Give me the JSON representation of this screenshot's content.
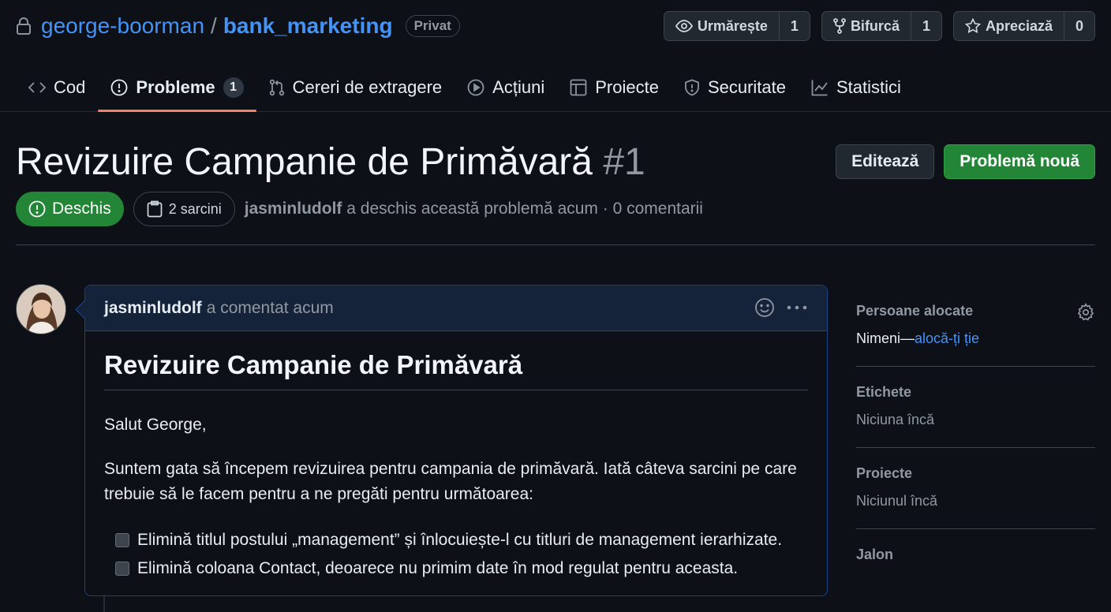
{
  "repo": {
    "owner": "george-boorman",
    "separator": "/",
    "name": "bank_marketing",
    "visibility": "Privat",
    "actions": [
      {
        "label": "Urmărește",
        "count": "1",
        "icon": "eye-icon"
      },
      {
        "label": "Bifurcă",
        "count": "1",
        "icon": "repo-forked-icon"
      },
      {
        "label": "Apreciază",
        "count": "0",
        "icon": "star-icon"
      }
    ]
  },
  "nav": {
    "tabs": [
      {
        "label": "Cod",
        "icon": "code-icon"
      },
      {
        "label": "Probleme",
        "icon": "issue-opened-icon",
        "counter": "1",
        "selected": true
      },
      {
        "label": "Cereri de extragere",
        "icon": "git-pull-request-icon"
      },
      {
        "label": "Acțiuni",
        "icon": "play-icon"
      },
      {
        "label": "Proiecte",
        "icon": "table-icon"
      },
      {
        "label": "Securitate",
        "icon": "shield-icon"
      },
      {
        "label": "Statistici",
        "icon": "graph-icon"
      }
    ]
  },
  "issue": {
    "title": "Revizuire Campanie de Primăvară",
    "number": "#1",
    "edit_label": "Editează",
    "new_issue_label": "Problemă nouă",
    "state": "Deschis",
    "tasks": "2 sarcini",
    "author": "jasminludolf",
    "meta": " a deschis această problemă acum · 0 comentarii"
  },
  "comment": {
    "author": "jasminludolf",
    "when": "a comentat acum",
    "heading": "Revizuire Campanie de Primăvară",
    "greeting": "Salut George,",
    "paragraph": "Suntem gata să începem revizuirea pentru campania de primăvară. Iată câteva sarcini pe care trebuie să le facem pentru a ne pregăti pentru următoarea:",
    "tasks": [
      "Elimină titlul postului „management” și înlocuiește-l cu titluri de management ierarhizate.",
      "Elimină coloana Contact, deoarece nu primim date în mod regulat pentru aceasta."
    ]
  },
  "sidebar": {
    "assignees": {
      "heading": "Persoane alocate",
      "value": "Nimeni—",
      "link": "alocă-ți ție"
    },
    "labels": {
      "heading": "Etichete",
      "value": "Niciuna încă"
    },
    "projects": {
      "heading": "Proiecte",
      "value": "Niciunul încă"
    },
    "milestone": {
      "heading": "Jalon"
    }
  },
  "colors": {
    "background": "#0d1117",
    "accent_link": "#4493f8",
    "success": "#238636",
    "tab_underline": "#f78166"
  }
}
